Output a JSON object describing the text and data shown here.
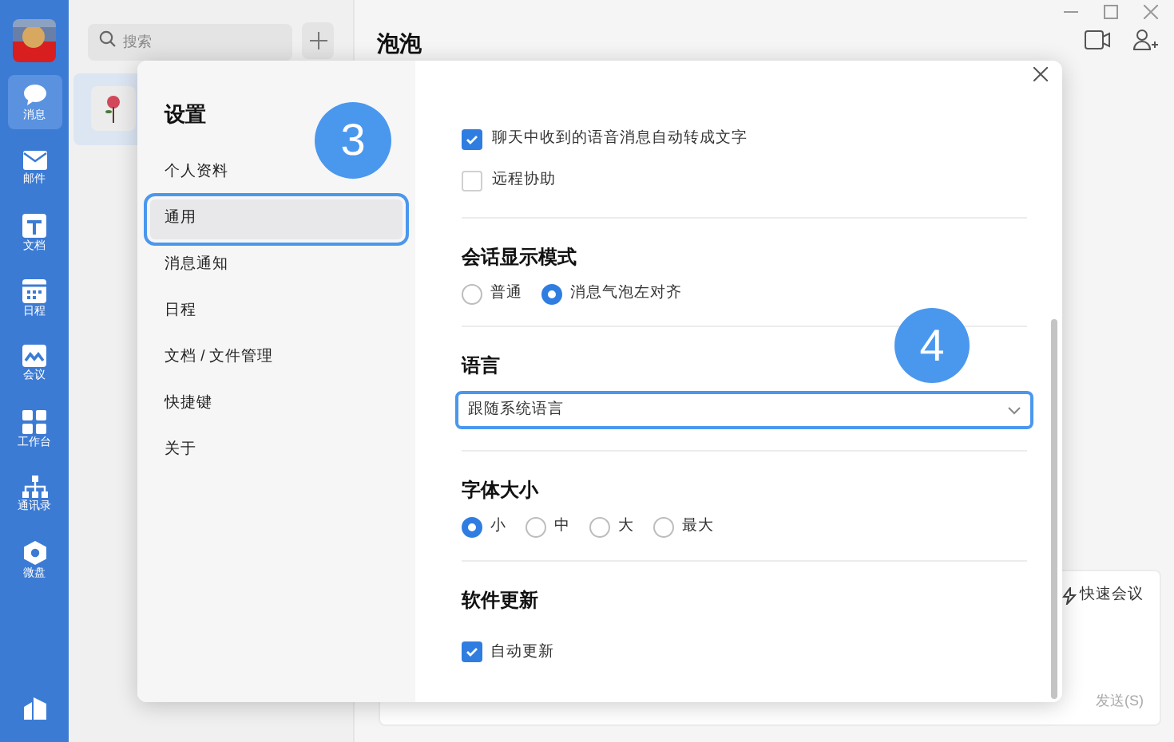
{
  "rail": {
    "items": [
      {
        "label": "消息",
        "selected": true
      },
      {
        "label": "邮件",
        "selected": false
      },
      {
        "label": "文档",
        "selected": false
      },
      {
        "label": "日程",
        "selected": false
      },
      {
        "label": "会议",
        "selected": false
      },
      {
        "label": "工作台",
        "selected": false
      },
      {
        "label": "通讯录",
        "selected": false
      },
      {
        "label": "微盘",
        "selected": false
      }
    ]
  },
  "search": {
    "placeholder": "搜索"
  },
  "chat": {
    "title": "泡泡",
    "quick_meeting": "快速会议",
    "send": "发送(S)"
  },
  "settings": {
    "title": "设置",
    "nav": [
      {
        "label": "个人资料",
        "selected": false
      },
      {
        "label": "通用",
        "selected": true
      },
      {
        "label": "消息通知",
        "selected": false
      },
      {
        "label": "日程",
        "selected": false
      },
      {
        "label": "文档 / 文件管理",
        "selected": false
      },
      {
        "label": "快捷键",
        "selected": false
      },
      {
        "label": "关于",
        "selected": false
      }
    ],
    "options": [
      {
        "label": "聊天中收到的语音消息自动转成文字",
        "checked": true
      },
      {
        "label": "远程协助",
        "checked": false
      }
    ],
    "sections": [
      {
        "kind": "radio",
        "title": "会话显示模式",
        "choices": [
          {
            "label": "普通",
            "selected": false
          },
          {
            "label": "消息气泡左对齐",
            "selected": true
          }
        ]
      },
      {
        "kind": "select",
        "title": "语言",
        "value": "跟随系统语言"
      },
      {
        "kind": "radio",
        "title": "字体大小",
        "choices": [
          {
            "label": "小",
            "selected": true
          },
          {
            "label": "中",
            "selected": false
          },
          {
            "label": "大",
            "selected": false
          },
          {
            "label": "最大",
            "selected": false
          }
        ]
      },
      {
        "kind": "checkbox",
        "title": "软件更新",
        "choices": [
          {
            "label": "自动更新",
            "checked": true
          }
        ]
      }
    ]
  },
  "annotations": [
    "3",
    "4"
  ]
}
